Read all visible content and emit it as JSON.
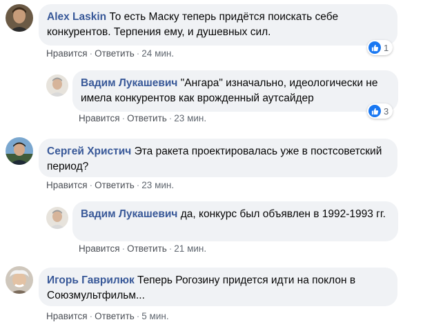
{
  "ui": {
    "accent": "#385898",
    "bubble_bg": "#f0f2f5",
    "like_color": "#1877f2"
  },
  "comments": [
    {
      "author": "Alex Laskin",
      "text": "То есть Маску теперь придётся поискать себе конкурентов. Терпения ему, и душевных сил.",
      "like": "Нравится",
      "reply": "Ответить",
      "time": "24 мин.",
      "reactions": "1",
      "reaction_icon": "thumbs-up-icon"
    },
    {
      "author": "Вадим Лукашевич",
      "text": "\"Ангара\" изначально, идеологически не имела конкурентов как врожденный аутсайдер",
      "like": "Нравится",
      "reply": "Ответить",
      "time": "23 мин.",
      "reactions": "3",
      "reaction_icon": "thumbs-up-icon"
    },
    {
      "author": "Сергей Христич",
      "text": "Эта ракета проектировалась уже в постсоветский период?",
      "like": "Нравится",
      "reply": "Ответить",
      "time": "23 мин."
    },
    {
      "author": "Вадим Лукашевич",
      "text": "да, конкурс был объявлен в 1992-1993 гг.",
      "like": "Нравится",
      "reply": "Ответить",
      "time": "21 мин."
    },
    {
      "author": "Игорь Гаврилюк",
      "text": "Теперь Рогозину придется идти на поклон в Союзмультфильм...",
      "like": "Нравится",
      "reply": "Ответить",
      "time": "5 мин."
    }
  ],
  "separator": "·"
}
